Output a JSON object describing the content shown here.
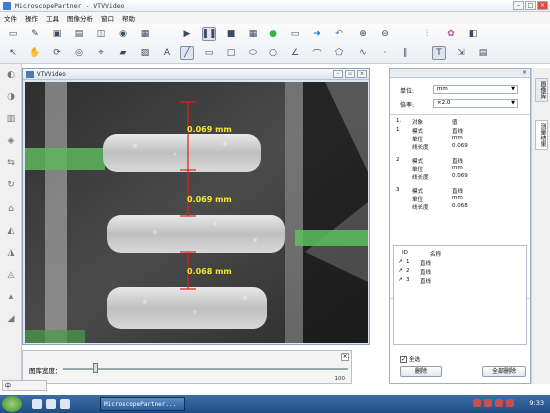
{
  "app": {
    "title": "MicroscopePartner - VTVVideo"
  },
  "menu": [
    "文件",
    "操作",
    "工具",
    "图像分析",
    "窗口",
    "帮助"
  ],
  "video_window": {
    "title": "VTVVideo"
  },
  "measurements_overlay": [
    {
      "label": "0.069 mm"
    },
    {
      "label": "0.069 mm"
    },
    {
      "label": "0.068 mm"
    }
  ],
  "bottom_panel": {
    "label": "图库宽度：",
    "max_value": "100"
  },
  "right_panel": {
    "unit_label": "单位:",
    "unit_value": "mm",
    "magnification_label": "倍率:",
    "magnification_value": "×2.0",
    "table_header": {
      "col1": "对象",
      "col2": "值",
      "index": "1."
    },
    "measurements": [
      {
        "index": "1",
        "rows": [
          [
            "模式",
            "直线"
          ],
          [
            "单位",
            "mm"
          ],
          [
            "线长度",
            "0.069"
          ]
        ]
      },
      {
        "index": "2",
        "rows": [
          [
            "模式",
            "直线"
          ],
          [
            "单位",
            "mm"
          ],
          [
            "线长度",
            "0.069"
          ]
        ]
      },
      {
        "index": "3",
        "rows": [
          [
            "模式",
            "直线"
          ],
          [
            "单位",
            "mm"
          ],
          [
            "线长度",
            "0.068"
          ]
        ]
      }
    ],
    "list": {
      "header_id": "ID",
      "header_name": "名称",
      "items": [
        {
          "id": "1",
          "name": "直线"
        },
        {
          "id": "2",
          "name": "直线"
        },
        {
          "id": "3",
          "name": "直线"
        }
      ]
    },
    "select_all": "全选",
    "delete_button": "删除",
    "delete_all_button": "全部删除"
  },
  "side_tabs": [
    "图像库",
    "测量结果"
  ],
  "langbar": {
    "text": "中"
  },
  "taskbar": {
    "task_label": "MicroscopePartner...",
    "clock": "9:33"
  },
  "colors": {
    "accent": "#3b7bd0",
    "measure_line": "#e21f1f",
    "measure_text": "#f2ea2b",
    "green_pad": "#62c462"
  }
}
